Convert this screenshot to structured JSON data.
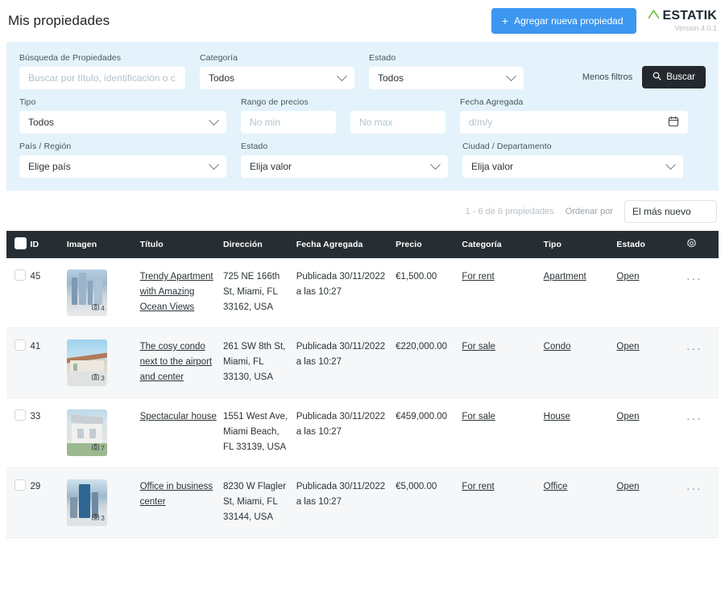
{
  "header": {
    "title": "Mis propiedades",
    "add_button": "Agregar nueva propiedad",
    "add_icon": "plus-icon",
    "brand_name": "ESTATIK",
    "brand_icon": "house-roof-icon",
    "version": "Version 4.0.1"
  },
  "filters": {
    "search": {
      "label": "Búsqueda de Propiedades",
      "placeholder": "Buscar por título, identificación o c",
      "value": ""
    },
    "category": {
      "label": "Categoría",
      "value": "Todos"
    },
    "status": {
      "label": "Estado",
      "value": "Todos"
    },
    "type": {
      "label": "Tipo",
      "value": "Todos"
    },
    "price_range": {
      "label": "Rango de precios",
      "min_placeholder": "No min",
      "max_placeholder": "No max",
      "min_value": "",
      "max_value": ""
    },
    "date_added": {
      "label": "Fecha Agregada",
      "placeholder": "d/m/y",
      "value": "",
      "icon": "calendar-icon"
    },
    "country": {
      "label": "País / Región",
      "value": "Elige país"
    },
    "state": {
      "label": "Estado",
      "value": "Elija valor"
    },
    "city": {
      "label": "Ciudad / Departamento",
      "value": "Elija valor"
    },
    "toggle_filters": "Menos filtros",
    "search_button": "Buscar",
    "search_button_icon": "search-icon"
  },
  "results": {
    "count_text": "1 - 6 de 6 propiedades",
    "sort_label": "Ordenar por",
    "sort_value": "El más nuevo"
  },
  "table": {
    "columns": [
      "ID",
      "Imagen",
      "Título",
      "Dirección",
      "Fecha Agregada",
      "Precio",
      "Categoría",
      "Tipo",
      "Estado"
    ],
    "settings_icon": "gear-icon",
    "rows": [
      {
        "id": "45",
        "photos": "4",
        "thumb": "city-skyline",
        "title": "Trendy Apartment with Amazing Ocean Views",
        "address": "725 NE 166th St, Miami, FL 33162, USA",
        "date": "Publicada 30/11/2022 a las 10:27",
        "price": "€1,500.00",
        "category": "For rent",
        "type": "Apartment",
        "status": "Open",
        "actions_icon": "more-options-icon"
      },
      {
        "id": "41",
        "photos": "3",
        "thumb": "villa",
        "title": "The cosy condo next to the airport and center",
        "address": "261 SW 8th St, Miami, FL 33130, USA",
        "date": "Publicada 30/11/2022 a las 10:27",
        "price": "€220,000.00",
        "category": "For sale",
        "type": "Condo",
        "status": "Open",
        "actions_icon": "more-options-icon"
      },
      {
        "id": "33",
        "photos": "7",
        "thumb": "house",
        "title": "Spectacular house",
        "address": "1551 West Ave, Miami Beach, FL 33139, USA",
        "date": "Publicada 30/11/2022 a las 10:27",
        "price": "€459,000.00",
        "category": "For sale",
        "type": "House",
        "status": "Open",
        "actions_icon": "more-options-icon"
      },
      {
        "id": "29",
        "photos": "3",
        "thumb": "office",
        "title": "Office in business center",
        "address": "8230 W Flagler St, Miami, FL 33144, USA",
        "date": "Publicada 30/11/2022 a las 10:27",
        "price": "€5,000.00",
        "category": "For rent",
        "type": "Office",
        "status": "Open",
        "actions_icon": "more-options-icon"
      }
    ]
  },
  "colors": {
    "accent_blue": "#3c97f0",
    "panel_bg": "#e4f3fb",
    "dark": "#272e33",
    "brand_green": "#6fbe44"
  }
}
